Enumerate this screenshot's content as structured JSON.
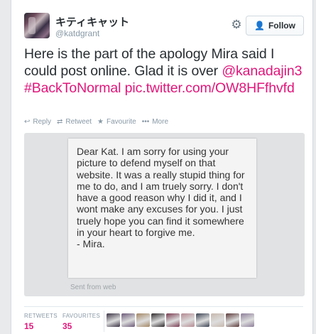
{
  "user": {
    "display_name": "キティキャット",
    "handle": "@katdgrant"
  },
  "follow_button": {
    "label": "Follow",
    "icon": "add-user-icon"
  },
  "settings": {
    "icon": "gear-icon"
  },
  "tweet": {
    "text_plain": "Here is the part of the apology Mira said I could post online. Glad it is over",
    "mention": "@kanadajin3",
    "hashtag": "#BackToNormal",
    "pic_link": "pic.twitter.com/OW8HFfhvfd"
  },
  "actions": {
    "reply": "Reply",
    "retweet": "Retweet",
    "favourite": "Favourite",
    "more": "More"
  },
  "media": {
    "letter_text": "Dear Kat.  I am sorry for using your picture to defend myself on that website. It was a really stupid thing for me to do, and I am truely sorry. I don't have a good reason why I did it, and I wont make any excuses for you. I just truely  hope you can find it somewhere in your heart to forgive me.\n- Mira.",
    "sent_from": "Sent from web"
  },
  "stats": {
    "retweets_label": "RETWEETS",
    "retweets_value": "15",
    "favourites_label": "FAVOURITES",
    "favourites_value": "35"
  },
  "colors": {
    "link": "#e0167b",
    "text": "#292f33",
    "muted": "#8899a6",
    "follow_icon": "#2b7bb9"
  },
  "favouriter_avatars": [
    {
      "name": "avatar-1",
      "color": "#3b3345"
    },
    {
      "name": "avatar-2",
      "color": "#6b5a78"
    },
    {
      "name": "avatar-3",
      "color": "#a48865"
    },
    {
      "name": "avatar-4",
      "color": "#2f2a2c"
    },
    {
      "name": "avatar-5",
      "color": "#7a3d52"
    },
    {
      "name": "avatar-6",
      "color": "#b48a92"
    },
    {
      "name": "avatar-7",
      "color": "#3c4454"
    },
    {
      "name": "avatar-8",
      "color": "#c7b8ad"
    },
    {
      "name": "avatar-9",
      "color": "#5d3b3b"
    },
    {
      "name": "avatar-10",
      "color": "#8d7f9a"
    }
  ]
}
